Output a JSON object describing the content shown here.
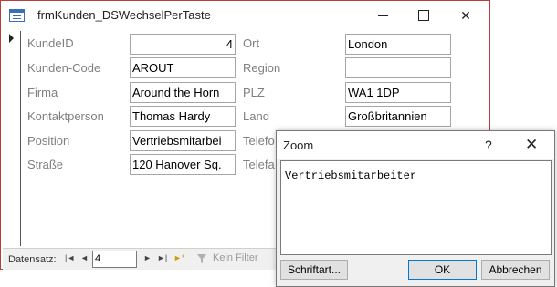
{
  "window": {
    "title": "frmKunden_DSWechselPerTaste"
  },
  "form": {
    "left_labels": [
      "KundeID",
      "Kunden-Code",
      "Firma",
      "Kontaktperson",
      "Position",
      "Straße"
    ],
    "left_values": [
      "4",
      "AROUT",
      "Around the Horn",
      "Thomas Hardy",
      "Vertriebsmitarbei",
      "120 Hanover Sq."
    ],
    "right_labels": [
      "Ort",
      "Region",
      "PLZ",
      "Land",
      "Telefo",
      "Telefa"
    ],
    "right_values": [
      "London",
      "",
      "WA1 1DP",
      "Großbritannien"
    ]
  },
  "navigation": {
    "label": "Datensatz:",
    "current_record": "4",
    "filter_label": "Kein Filter",
    "buttons": [
      "|◄",
      "◄",
      "►",
      "►|",
      "►*"
    ]
  },
  "zoom_dialog": {
    "title": "Zoom",
    "help": "?",
    "close": "✕",
    "content": "Vertriebsmitarbeiter",
    "font_button": "Schriftart...",
    "ok_button": "OK",
    "cancel_button": "Abbrechen"
  },
  "colors": {
    "window_border": "#b83c3c",
    "label_text": "#7f7f7f",
    "ok_focus": "#0078d7"
  }
}
